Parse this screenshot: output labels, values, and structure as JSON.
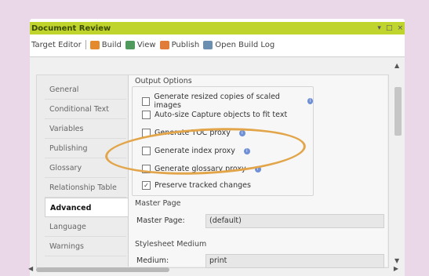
{
  "window": {
    "title": "Document Review",
    "controls": [
      "▾",
      "□",
      "×"
    ]
  },
  "toolbar": {
    "target_editor": "Target Editor",
    "build": "Build",
    "view": "View",
    "publish": "Publish",
    "open_build_log": "Open Build Log"
  },
  "tabs": [
    {
      "label": "General"
    },
    {
      "label": "Conditional Text"
    },
    {
      "label": "Variables"
    },
    {
      "label": "Publishing"
    },
    {
      "label": "Glossary"
    },
    {
      "label": "Relationship Table"
    },
    {
      "label": "Advanced",
      "active": true
    },
    {
      "label": "Language"
    },
    {
      "label": "Warnings"
    }
  ],
  "output_options": {
    "title": "Output Options",
    "options": [
      {
        "label": "Generate resized copies of scaled images",
        "checked": false,
        "info": true
      },
      {
        "label": "Auto-size Capture objects to fit text",
        "checked": false,
        "info": false
      },
      {
        "label": "Generate TOC proxy",
        "checked": false,
        "info": true
      },
      {
        "label": "Generate index proxy",
        "checked": false,
        "info": true
      },
      {
        "label": "Generate glossary proxy",
        "checked": false,
        "info": true
      },
      {
        "label": "Preserve tracked changes",
        "checked": true,
        "info": false
      }
    ]
  },
  "master_page": {
    "title": "Master Page",
    "label": "Master Page:",
    "value": "(default)"
  },
  "stylesheet_medium": {
    "title": "Stylesheet Medium",
    "label": "Medium:",
    "value": "print"
  },
  "icons": {
    "info": "i",
    "check": "✓",
    "scroll_up": "▲",
    "scroll_down": "▼",
    "scroll_left": "◀",
    "scroll_right": "▶"
  },
  "colors": {
    "titlebar": "#bfd42c",
    "highlight": "#e2a54a",
    "background": "#ead8e8"
  }
}
